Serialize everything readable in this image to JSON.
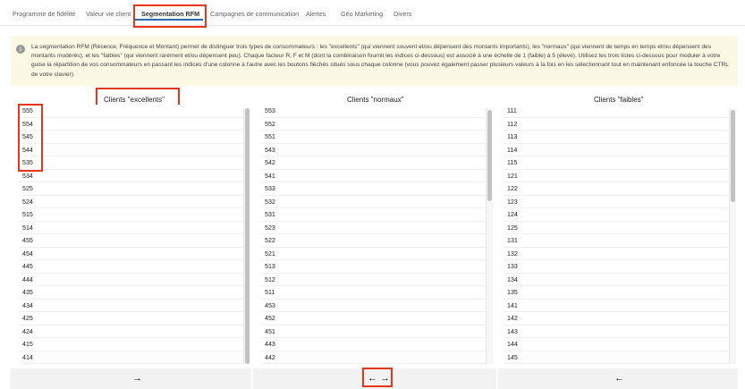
{
  "tabs": [
    {
      "label": "Programme de fidélité"
    },
    {
      "label": "Valeur vie client"
    },
    {
      "label": "Segmentation RFM"
    },
    {
      "label": "Campagnes de communication"
    },
    {
      "label": "Alertes"
    },
    {
      "label": "Géo Marketing"
    },
    {
      "label": "Divers"
    }
  ],
  "info": {
    "icon": "info-icon",
    "text": "La segmentation RFM (Récence, Fréquence et Montant) permet de distinguer trois types de consommateurs : les \"excellents\" (qui viennent souvent et/ou dépensent des montants importants), les \"normaux\" (qui viennent de temps en temps et/ou dépensent des montants modérés), et les \"faibles\" (qui viennent rarement et/ou dépensent peu). Chaque facteur R, F et M (dont la combinaison fournit les indices ci-dessous) est associé à une échelle de 1 (faible) à 5 (élevé). Utilisez les trois listes ci-dessous pour moduler à votre guise la répartition de vos consommateurs en passant les indices d'une colonne à l'autre avec les boutons fléchés situés sous chaque colonne (vous pouvez également passer plusieurs valeurs à la fois en les sélectionnant tout en maintenant enfoncée la touche CTRL de votre clavier)."
  },
  "columns": {
    "excellent": {
      "title": "Clients \"excellents\"",
      "items": [
        "555",
        "554",
        "545",
        "544",
        "535",
        "534",
        "525",
        "524",
        "515",
        "514",
        "455",
        "454",
        "445",
        "444",
        "435",
        "434",
        "425",
        "424",
        "415",
        "414"
      ]
    },
    "normal": {
      "title": "Clients \"normaux\"",
      "items": [
        "553",
        "552",
        "551",
        "543",
        "542",
        "541",
        "533",
        "532",
        "531",
        "523",
        "522",
        "521",
        "513",
        "512",
        "511",
        "453",
        "452",
        "451",
        "443",
        "442"
      ]
    },
    "weak": {
      "title": "Clients \"faibles\"",
      "items": [
        "111",
        "112",
        "113",
        "114",
        "115",
        "121",
        "122",
        "123",
        "124",
        "125",
        "131",
        "132",
        "133",
        "134",
        "135",
        "141",
        "142",
        "143",
        "144",
        "145"
      ]
    }
  },
  "buttons": {
    "move_right": "→",
    "move_left": "←"
  },
  "colors": {
    "accent": "#2b6cb0",
    "highlight": "#e8361c",
    "info_bg": "#fbf8e3"
  }
}
